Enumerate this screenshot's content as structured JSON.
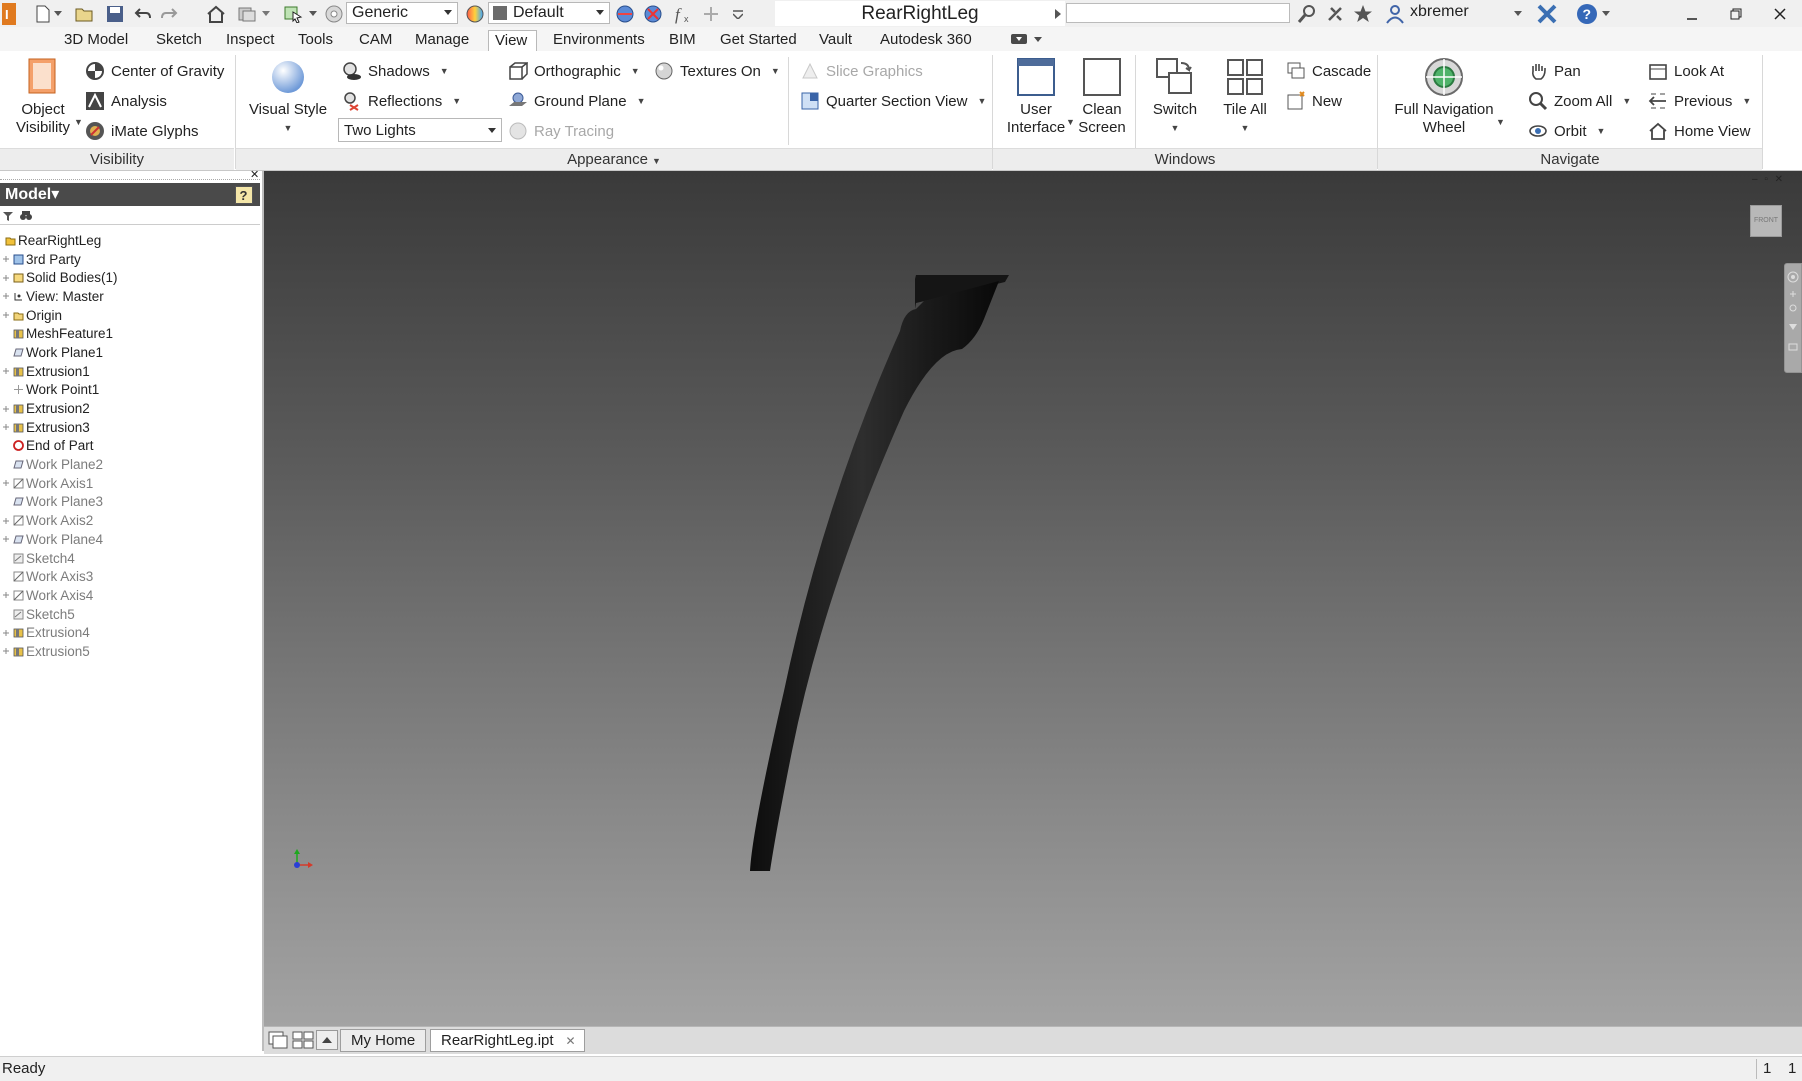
{
  "title_bar": {
    "material_value": "Generic",
    "appearance_value": "Default",
    "document_title": "RearRightLeg",
    "username": "xbremer"
  },
  "tabs": [
    "3D Model",
    "Sketch",
    "Inspect",
    "Tools",
    "CAM",
    "Manage",
    "View",
    "Environments",
    "BIM",
    "Get Started",
    "Vault",
    "Autodesk 360"
  ],
  "active_tab": "View",
  "ribbon": {
    "visibility": {
      "panel_name": "Visibility",
      "object_visibility": [
        "Object",
        "Visibility"
      ],
      "center_of_gravity": "Center of Gravity",
      "analysis": "Analysis",
      "imate_glyphs": "iMate Glyphs"
    },
    "appearance": {
      "panel_name": "Appearance",
      "visual_style": "Visual Style",
      "shadows": "Shadows",
      "reflections": "Reflections",
      "lighting_value": "Two Lights",
      "orthographic": "Orthographic",
      "ground_plane": "Ground Plane",
      "ray_tracing": "Ray Tracing",
      "textures_on": "Textures On",
      "slice_graphics": "Slice Graphics",
      "quarter_section_view": "Quarter Section View"
    },
    "windows": {
      "panel_name": "Windows",
      "user_interface": [
        "User",
        "Interface"
      ],
      "clean_screen": [
        "Clean",
        "Screen"
      ],
      "switch": "Switch",
      "tile_all": "Tile All",
      "cascade": "Cascade",
      "new": "New"
    },
    "navigate": {
      "panel_name": "Navigate",
      "full_navigation_wheel": [
        "Full Navigation",
        "Wheel"
      ],
      "pan": "Pan",
      "zoom_all": "Zoom All",
      "orbit": "Orbit",
      "look_at": "Look At",
      "previous": "Previous",
      "home_view": "Home View"
    }
  },
  "browser": {
    "title": "Model",
    "tree": [
      {
        "label": "RearRightLeg",
        "expander": false,
        "dim": false
      },
      {
        "label": "3rd Party",
        "expander": true,
        "dim": false
      },
      {
        "label": "Solid Bodies(1)",
        "expander": true,
        "dim": false
      },
      {
        "label": "View: Master",
        "expander": true,
        "dim": false
      },
      {
        "label": "Origin",
        "expander": true,
        "dim": false
      },
      {
        "label": "MeshFeature1",
        "expander": false,
        "dim": false
      },
      {
        "label": "Work Plane1",
        "expander": false,
        "dim": false
      },
      {
        "label": "Extrusion1",
        "expander": true,
        "dim": false
      },
      {
        "label": "Work Point1",
        "expander": false,
        "dim": false
      },
      {
        "label": "Extrusion2",
        "expander": true,
        "dim": false
      },
      {
        "label": "Extrusion3",
        "expander": true,
        "dim": false
      },
      {
        "label": "End of Part",
        "expander": false,
        "dim": false
      },
      {
        "label": "Work Plane2",
        "expander": false,
        "dim": true
      },
      {
        "label": "Work Axis1",
        "expander": true,
        "dim": true
      },
      {
        "label": "Work Plane3",
        "expander": false,
        "dim": true
      },
      {
        "label": "Work Axis2",
        "expander": true,
        "dim": true
      },
      {
        "label": "Work Plane4",
        "expander": true,
        "dim": true
      },
      {
        "label": "Sketch4",
        "expander": false,
        "dim": true
      },
      {
        "label": "Work Axis3",
        "expander": false,
        "dim": true
      },
      {
        "label": "Work Axis4",
        "expander": true,
        "dim": true
      },
      {
        "label": "Sketch5",
        "expander": false,
        "dim": true
      },
      {
        "label": "Extrusion4",
        "expander": true,
        "dim": true
      },
      {
        "label": "Extrusion5",
        "expander": true,
        "dim": true
      }
    ]
  },
  "viewcube_label": "FRONT",
  "doc_tabs": [
    "My Home",
    "RearRightLeg.ipt"
  ],
  "status": {
    "text": "Ready",
    "count1": "1",
    "count2": "1"
  }
}
